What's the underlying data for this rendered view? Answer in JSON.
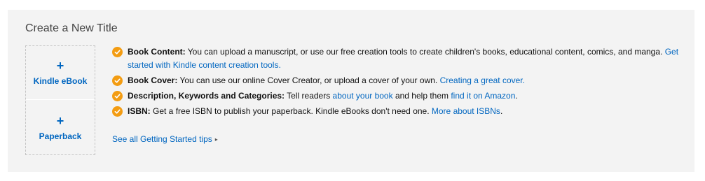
{
  "panel": {
    "title": "Create a New Title"
  },
  "create": {
    "ebook": {
      "plus": "+",
      "label": "Kindle eBook"
    },
    "paperback": {
      "plus": "+",
      "label": "Paperback"
    }
  },
  "tips": [
    {
      "heading": "Book Content:",
      "text": " You can upload a manuscript, or use our free creation tools to create children's books, educational content, comics, and manga. ",
      "link": "Get started with Kindle content creation tools."
    },
    {
      "heading": "Book Cover:",
      "text": " You can use our online Cover Creator, or upload a cover of your own. ",
      "link": "Creating a great cover."
    },
    {
      "heading": "Description, Keywords and Categories:",
      "text": " Tell readers ",
      "link": "about your book",
      "text2": " and help them ",
      "link2": "find it on Amazon",
      "text3": "."
    },
    {
      "heading": "ISBN:",
      "text": " Get a free ISBN to publish your paperback. Kindle eBooks don't need one. ",
      "link": "More about ISBNs",
      "text2": "."
    }
  ],
  "see_all": {
    "label": "See all Getting Started tips",
    "caret": "▸"
  },
  "colors": {
    "accent": "#f39c12",
    "link": "#0066c0",
    "panel_bg": "#f3f3f3"
  },
  "icons": {
    "tip_bullet": "check-circle-icon"
  }
}
